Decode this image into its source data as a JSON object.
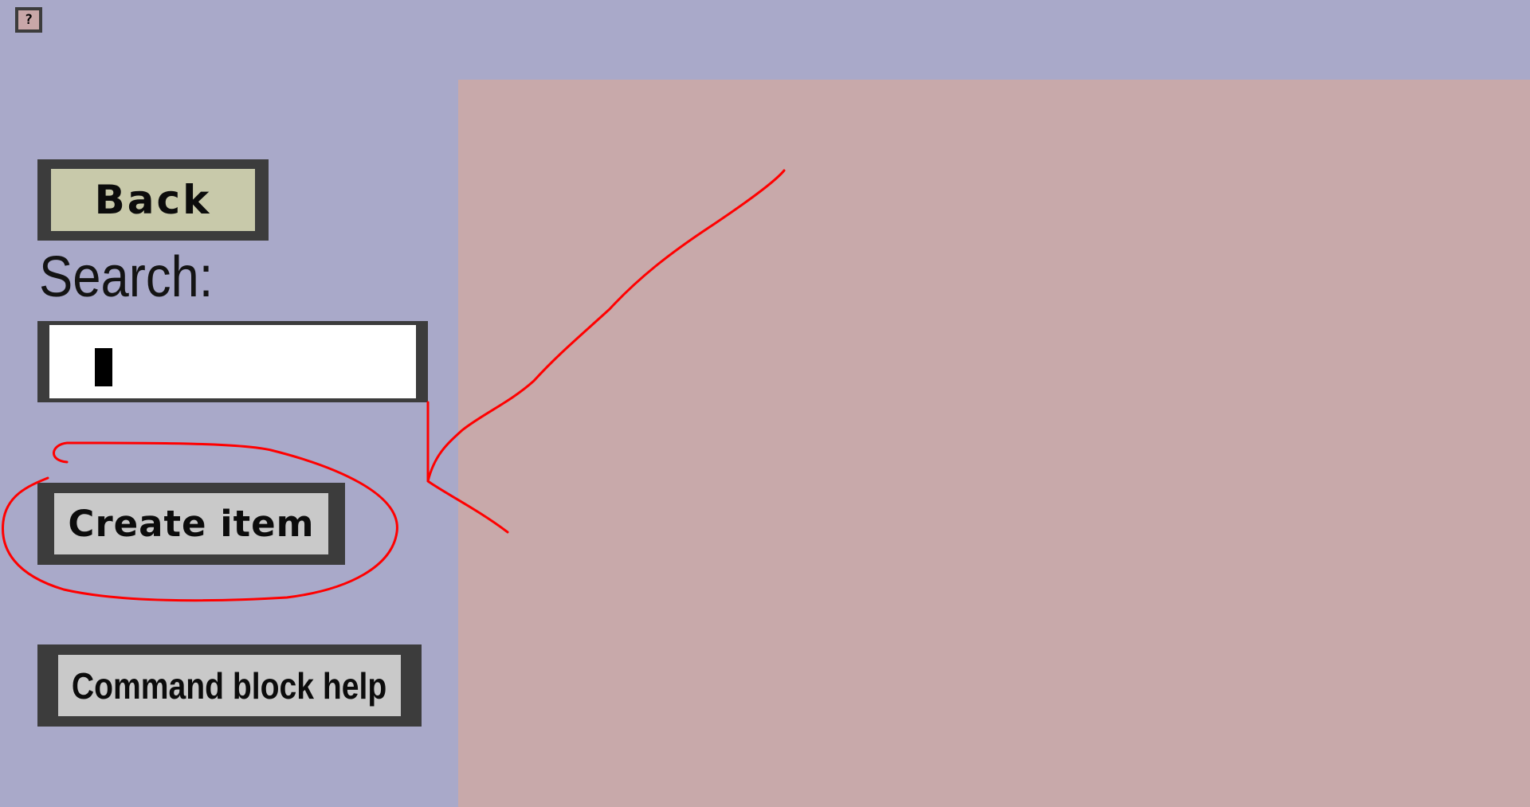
{
  "help_button": {
    "label": "?"
  },
  "back_button": {
    "label": "Back"
  },
  "search": {
    "label": "Search:",
    "value": "",
    "placeholder": ""
  },
  "create_item_button": {
    "label": "Create item"
  },
  "command_block_help_button": {
    "label": "Command block help"
  },
  "colors": {
    "background": "#a9a9c9",
    "content_panel": "#c8a9aa",
    "button_frame": "#3c3c3c",
    "back_button_face": "#c8c9aa",
    "button_face": "#c9c9c9",
    "annotation": "#ff0000"
  }
}
